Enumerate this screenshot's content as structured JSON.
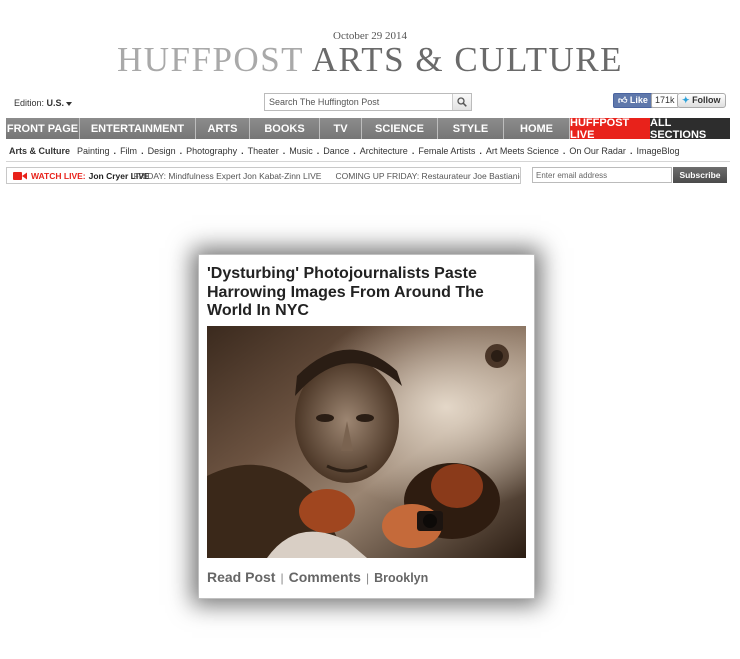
{
  "header": {
    "date": "October 29 2014",
    "brand": "HUFFPOST",
    "section": "ARTS & CULTURE"
  },
  "edition": {
    "label": "Edition:",
    "value": "U.S."
  },
  "search": {
    "placeholder": "Search The Huffington Post"
  },
  "social": {
    "like_label": "Like",
    "like_count": "171k",
    "follow_label": "Follow"
  },
  "nav": {
    "items": [
      {
        "label": "FRONT PAGE"
      },
      {
        "label": "ENTERTAINMENT"
      },
      {
        "label": "ARTS"
      },
      {
        "label": "BOOKS"
      },
      {
        "label": "TV"
      },
      {
        "label": "SCIENCE"
      },
      {
        "label": "STYLE"
      },
      {
        "label": "HOME"
      },
      {
        "label": "HUFFPOST LIVE"
      },
      {
        "label": "ALL SECTIONS"
      }
    ]
  },
  "subnav": {
    "title": "Arts & Culture",
    "links": [
      "Painting",
      "Film",
      "Design",
      "Photography",
      "Theater",
      "Music",
      "Dance",
      "Architecture",
      "Female Artists",
      "Art Meets Science",
      "On Our Radar",
      "ImageBlog"
    ]
  },
  "ticker": {
    "live_label": "WATCH LIVE:",
    "live_name": "Jon Cryer LIVE",
    "items": [
      "FRIDAY: Mindfulness Expert Jon Kabat-Zinn LIVE",
      "COMING UP FRIDAY: Restaurateur Joe Bastianich"
    ]
  },
  "newsletter": {
    "placeholder": "Enter email address",
    "button": "Subscribe"
  },
  "card": {
    "title": "'Dysturbing' Photojournalists Paste Harrowing Images From Around The World In NYC",
    "read_post": "Read Post",
    "comments": "Comments",
    "tag": "Brooklyn"
  },
  "colors": {
    "nav_gray": "#818181",
    "live_red": "#e8221b",
    "all_sections": "#2d2d2d",
    "facebook": "#5f78ab"
  }
}
